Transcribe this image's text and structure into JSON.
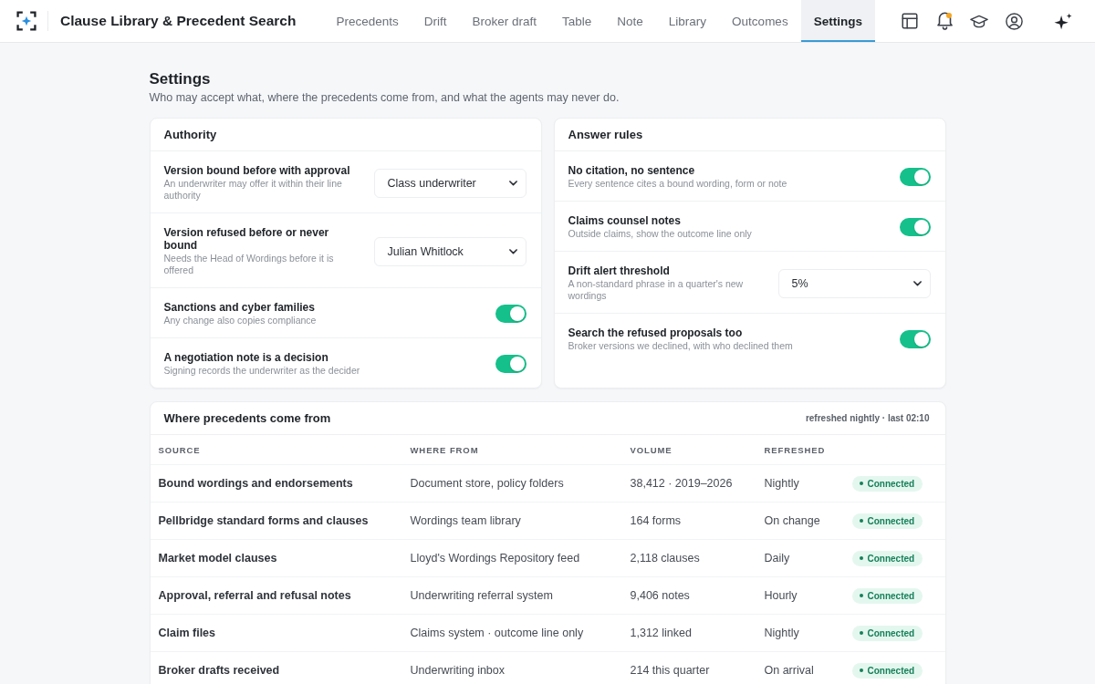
{
  "app": {
    "title": "Clause Library & Precedent Search"
  },
  "tabs": [
    {
      "label": "Precedents",
      "selected": false
    },
    {
      "label": "Drift",
      "selected": false
    },
    {
      "label": "Broker draft",
      "selected": false
    },
    {
      "label": "Table",
      "selected": false
    },
    {
      "label": "Note",
      "selected": false
    },
    {
      "label": "Library",
      "selected": false
    },
    {
      "label": "Outcomes",
      "selected": false
    },
    {
      "label": "Settings",
      "selected": true
    }
  ],
  "notifications": {
    "unread": true
  },
  "page": {
    "title": "Settings",
    "subtitle": "Who may accept what, where the precedents come from, and what the agents may never do."
  },
  "panels": [
    {
      "title": "Authority",
      "rows": [
        {
          "kind": "select",
          "label": "Version bound before with approval",
          "hint": "An underwriter may offer it within their line authority",
          "value": "Class underwriter"
        },
        {
          "kind": "select",
          "label": "Version refused before or never bound",
          "hint": "Needs the Head of Wordings before it is offered",
          "value": "Julian Whitlock"
        },
        {
          "kind": "toggle",
          "label": "Sanctions and cyber families",
          "hint": "Any change also copies compliance",
          "on": true
        },
        {
          "kind": "toggle",
          "label": "A negotiation note is a decision",
          "hint": "Signing records the underwriter as the decider",
          "on": true
        }
      ]
    },
    {
      "title": "Answer rules",
      "rows": [
        {
          "kind": "toggle",
          "label": "No citation, no sentence",
          "hint": "Every sentence cites a bound wording, form or note",
          "on": true
        },
        {
          "kind": "toggle",
          "label": "Claims counsel notes",
          "hint": "Outside claims, show the outcome line only",
          "on": true
        },
        {
          "kind": "select",
          "label": "Drift alert threshold",
          "hint": "A non-standard phrase in a quarter's new wordings",
          "value": "5%"
        },
        {
          "kind": "toggle",
          "label": "Search the refused proposals too",
          "hint": "Broker versions we declined, with who declined them",
          "on": true
        }
      ]
    }
  ],
  "sources": {
    "title": "Where precedents come from",
    "note": "refreshed nightly · last 02:10",
    "columns": [
      "SOURCE",
      "WHERE FROM",
      "VOLUME",
      "REFRESHED"
    ],
    "rows": [
      {
        "source": "Bound wordings and endorsements",
        "where_from": "Document store, policy folders",
        "volume": "38,412 · 2019–2026",
        "refreshed": "Nightly",
        "status": "Connected"
      },
      {
        "source": "Pellbridge standard forms and clauses",
        "where_from": "Wordings team library",
        "volume": "164 forms",
        "refreshed": "On change",
        "status": "Connected"
      },
      {
        "source": "Market model clauses",
        "where_from": "Lloyd's Wordings Repository feed",
        "volume": "2,118 clauses",
        "refreshed": "Daily",
        "status": "Connected"
      },
      {
        "source": "Approval, referral and refusal notes",
        "where_from": "Underwriting referral system",
        "volume": "9,406 notes",
        "refreshed": "Hourly",
        "status": "Connected"
      },
      {
        "source": "Claim files",
        "where_from": "Claims system · outcome line only",
        "volume": "1,312 linked",
        "refreshed": "Nightly",
        "status": "Connected"
      },
      {
        "source": "Broker drafts received",
        "where_from": "Underwriting inbox",
        "volume": "214 this quarter",
        "refreshed": "On arrival",
        "status": "Connected"
      }
    ]
  }
}
